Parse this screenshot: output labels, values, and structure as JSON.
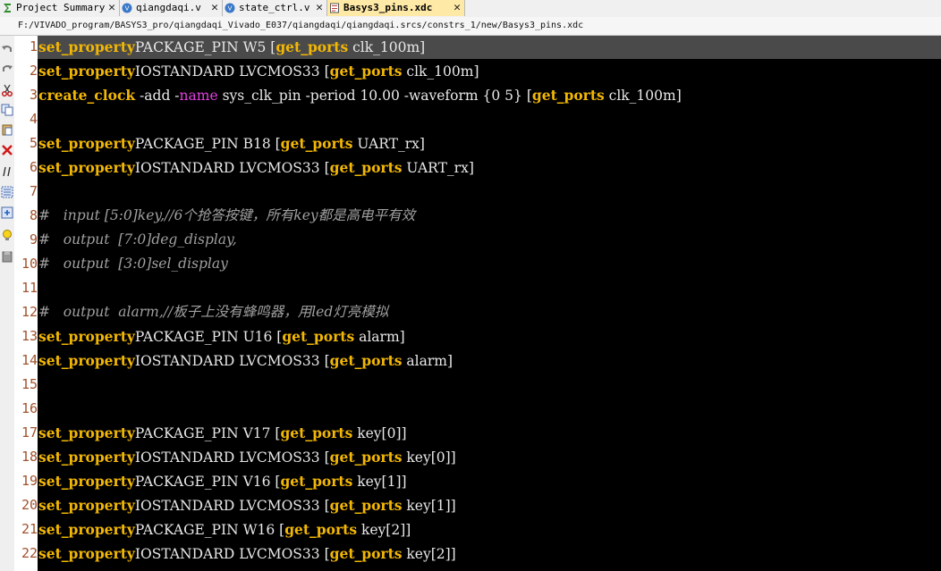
{
  "tabs": [
    {
      "label": "Project Summary",
      "icon": "sigma-icon",
      "active": false
    },
    {
      "label": "qiangdaqi.v",
      "icon": "verilog-file-icon",
      "active": false
    },
    {
      "label": "state_ctrl.v",
      "icon": "verilog-file-icon",
      "active": false
    },
    {
      "label": "Basys3_pins.xdc",
      "icon": "xdc-file-icon",
      "active": true
    }
  ],
  "close_glyph": "✕",
  "path": "F:/VIVADO_program/BASYS3_pro/qiangdaqi_Vivado_E037/qiangdaqi/qiangdaqi.srcs/constrs_1/new/Basys3_pins.xdc",
  "toolbar_icons": [
    "undo-icon",
    "redo-icon",
    "cut-icon",
    "copy-icon",
    "paste-icon",
    "delete-icon",
    "comment-icon",
    "select-all-icon",
    "insert-icon",
    "bulb-icon",
    "bookmark-icon"
  ],
  "lines": [
    {
      "n": "1",
      "h": true,
      "t": [
        [
          "kw",
          "set_property"
        ],
        [
          "",
          "PACKAGE_PIN W5 ["
        ],
        [
          "kw",
          "get_ports"
        ],
        [
          "",
          " clk_100m]"
        ]
      ]
    },
    {
      "n": "2",
      "t": [
        [
          "kw",
          "set_property"
        ],
        [
          "",
          "IOSTANDARD LVCMOS33 ["
        ],
        [
          "kw",
          "get_ports"
        ],
        [
          "",
          " clk_100m]"
        ]
      ]
    },
    {
      "n": "3",
      "t": [
        [
          "kw",
          "create_clock"
        ],
        [
          "",
          " -add -"
        ],
        [
          "mg",
          "name"
        ],
        [
          "",
          " sys_clk_pin -period 10.00 -waveform {0 5} ["
        ],
        [
          "kw",
          "get_ports"
        ],
        [
          "",
          " clk_100m]"
        ]
      ]
    },
    {
      "n": "4",
      "t": []
    },
    {
      "n": "5",
      "t": [
        [
          "kw",
          "set_property"
        ],
        [
          "",
          "PACKAGE_PIN B18 ["
        ],
        [
          "kw",
          "get_ports"
        ],
        [
          "",
          " UART_rx]"
        ]
      ]
    },
    {
      "n": "6",
      "t": [
        [
          "kw",
          "set_property"
        ],
        [
          "",
          "IOSTANDARD LVCMOS33 ["
        ],
        [
          "kw",
          "get_ports"
        ],
        [
          "",
          " UART_rx]"
        ]
      ]
    },
    {
      "n": "7",
      "t": []
    },
    {
      "n": "8",
      "t": [
        [
          "cm",
          "#   input [5:0]key,//6个抢答按键，所有key都是高电平有效"
        ]
      ]
    },
    {
      "n": "9",
      "t": [
        [
          "cm",
          "#   output  [7:0]deg_display,"
        ]
      ]
    },
    {
      "n": "10",
      "t": [
        [
          "cm",
          "#   output  [3:0]sel_display"
        ]
      ]
    },
    {
      "n": "11",
      "t": []
    },
    {
      "n": "12",
      "t": [
        [
          "cm",
          "#   output  alarm,//板子上没有蜂鸣器，用led灯亮模拟"
        ]
      ]
    },
    {
      "n": "13",
      "t": [
        [
          "kw",
          "set_property"
        ],
        [
          "",
          "PACKAGE_PIN U16 ["
        ],
        [
          "kw",
          "get_ports"
        ],
        [
          "",
          " alarm]"
        ]
      ]
    },
    {
      "n": "14",
      "t": [
        [
          "kw",
          "set_property"
        ],
        [
          "",
          "IOSTANDARD LVCMOS33 ["
        ],
        [
          "kw",
          "get_ports"
        ],
        [
          "",
          " alarm]"
        ]
      ]
    },
    {
      "n": "15",
      "t": []
    },
    {
      "n": "16",
      "t": []
    },
    {
      "n": "17",
      "t": [
        [
          "kw",
          "set_property"
        ],
        [
          "",
          "PACKAGE_PIN V17 ["
        ],
        [
          "kw",
          "get_ports"
        ],
        [
          "",
          " key[0]]"
        ]
      ]
    },
    {
      "n": "18",
      "t": [
        [
          "kw",
          "set_property"
        ],
        [
          "",
          "IOSTANDARD LVCMOS33 ["
        ],
        [
          "kw",
          "get_ports"
        ],
        [
          "",
          " key[0]]"
        ]
      ]
    },
    {
      "n": "19",
      "t": [
        [
          "kw",
          "set_property"
        ],
        [
          "",
          "PACKAGE_PIN V16 ["
        ],
        [
          "kw",
          "get_ports"
        ],
        [
          "",
          " key[1]]"
        ]
      ]
    },
    {
      "n": "20",
      "t": [
        [
          "kw",
          "set_property"
        ],
        [
          "",
          "IOSTANDARD LVCMOS33 ["
        ],
        [
          "kw",
          "get_ports"
        ],
        [
          "",
          " key[1]]"
        ]
      ]
    },
    {
      "n": "21",
      "t": [
        [
          "kw",
          "set_property"
        ],
        [
          "",
          "PACKAGE_PIN W16 ["
        ],
        [
          "kw",
          "get_ports"
        ],
        [
          "",
          " key[2]]"
        ]
      ]
    },
    {
      "n": "22",
      "t": [
        [
          "kw",
          "set_property"
        ],
        [
          "",
          "IOSTANDARD LVCMOS33 ["
        ],
        [
          "kw",
          "get_ports"
        ],
        [
          "",
          " key[2]]"
        ]
      ]
    }
  ],
  "colors": {
    "keyword": "#f2b705",
    "attr": "#e23fe2",
    "comment": "#a0a0a0",
    "text": "#e8e8e8",
    "bg": "#000000",
    "line_no": "#a0522d",
    "active_tab": "#ffe9a6"
  }
}
